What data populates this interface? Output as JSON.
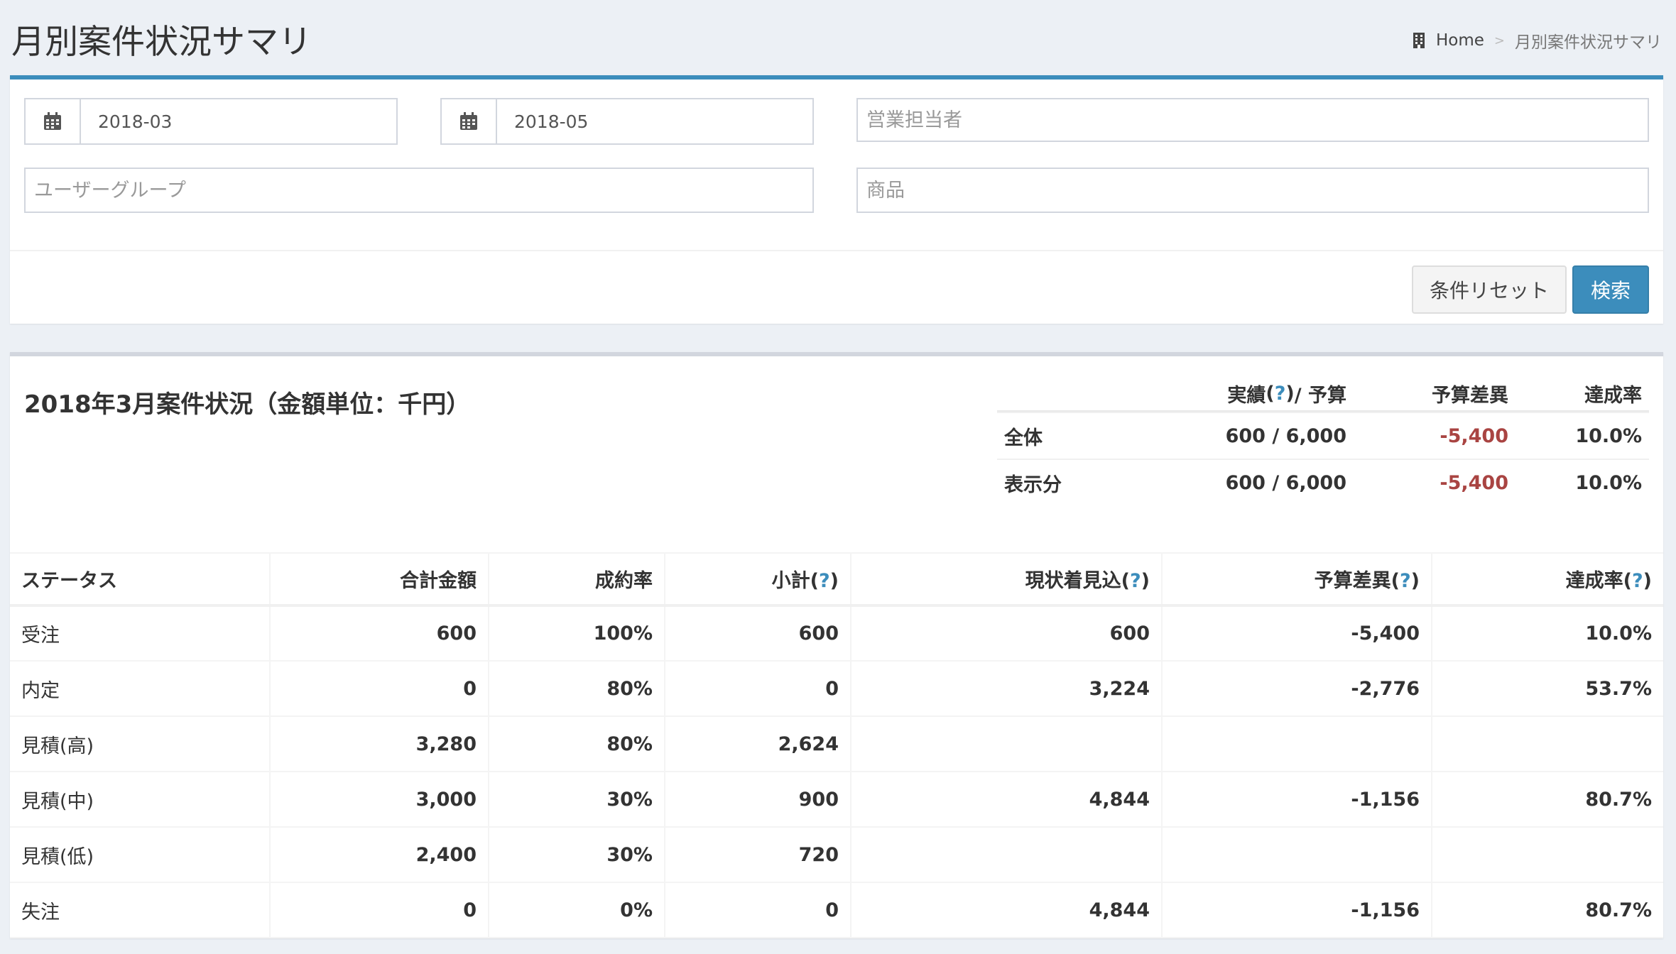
{
  "header": {
    "title": "月別案件状況サマリ",
    "breadcrumb_home": "Home",
    "breadcrumb_sep": ">",
    "breadcrumb_current": "月別案件状況サマリ"
  },
  "filters": {
    "date_from": "2018-03",
    "date_to": "2018-05",
    "sales_rep_placeholder": "営業担当者",
    "user_group_placeholder": "ユーザーグループ",
    "product_placeholder": "商品",
    "reset_label": "条件リセット",
    "search_label": "検索"
  },
  "summary": {
    "title": "2018年3月案件状況（金額単位：千円）",
    "headers": {
      "actual": "実績",
      "help": "?",
      "budget_suffix": " / 予算",
      "diff": "予算差異",
      "rate": "達成率"
    },
    "rows": [
      {
        "label": "全体",
        "actual_budget": "600 / 6,000",
        "diff": "-5,400",
        "rate": "10.0%"
      },
      {
        "label": "表示分",
        "actual_budget": "600 / 6,000",
        "diff": "-5,400",
        "rate": "10.0%"
      }
    ]
  },
  "status_table": {
    "columns": {
      "status": "ステータス",
      "total": "合計金額",
      "close_rate": "成約率",
      "subtotal": "小計",
      "forecast": "現状着見込",
      "diff": "予算差異",
      "rate": "達成率",
      "help": "?"
    },
    "rows": [
      {
        "status": "受注",
        "total": "600",
        "close_rate": "100%",
        "subtotal": "600",
        "forecast": "600",
        "diff": "-5,400",
        "rate": "10.0%"
      },
      {
        "status": "内定",
        "total": "0",
        "close_rate": "80%",
        "subtotal": "0",
        "forecast": "3,224",
        "diff": "-2,776",
        "rate": "53.7%"
      },
      {
        "status": "見積(高)",
        "total": "3,280",
        "close_rate": "80%",
        "subtotal": "2,624",
        "forecast": "",
        "diff": "",
        "rate": ""
      },
      {
        "status": "見積(中)",
        "total": "3,000",
        "close_rate": "30%",
        "subtotal": "900",
        "forecast": "4,844",
        "diff": "-1,156",
        "rate": "80.7%"
      },
      {
        "status": "見積(低)",
        "total": "2,400",
        "close_rate": "30%",
        "subtotal": "720",
        "forecast": "",
        "diff": "",
        "rate": ""
      },
      {
        "status": "失注",
        "total": "0",
        "close_rate": "0%",
        "subtotal": "0",
        "forecast": "4,844",
        "diff": "-1,156",
        "rate": "80.7%"
      }
    ]
  },
  "colors": {
    "accent": "#3c8dbc",
    "negative": "#a94442",
    "background": "#ecf0f5"
  }
}
